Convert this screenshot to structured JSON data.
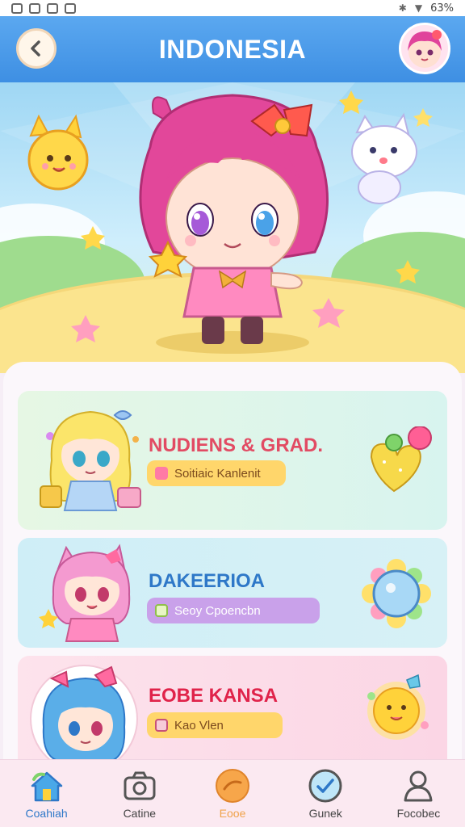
{
  "status_bar": {
    "battery": "63%"
  },
  "header": {
    "title": "INDONESIA",
    "back_icon": "chevron-left-icon"
  },
  "cards": [
    {
      "title": "NUDIENS & GRAD.",
      "badge": "Soitiaic Kanlenit",
      "deco_icon": "heart-balloon-icon"
    },
    {
      "title": "DAKEERIOA",
      "badge": "Seoy Cpoencbn",
      "deco_icon": "gem-flower-icon"
    },
    {
      "title": "EOBE KANSA",
      "badge": "Kao Vlen",
      "deco_icon": "sun-face-icon"
    }
  ],
  "nav": [
    {
      "label": "Coahiah",
      "icon": "home-icon"
    },
    {
      "label": "Catine",
      "icon": "camera-icon"
    },
    {
      "label": "Eooe",
      "icon": "orange-circle-icon"
    },
    {
      "label": "Gunek",
      "icon": "check-circle-icon"
    },
    {
      "label": "Focobec",
      "icon": "profile-icon"
    }
  ],
  "colors": {
    "header": "#3e8fe3",
    "accent_pink": "#e24b63",
    "accent_blue": "#2e78c8",
    "badge_yellow": "#ffd66b",
    "badge_purple": "#c9a1ea"
  }
}
